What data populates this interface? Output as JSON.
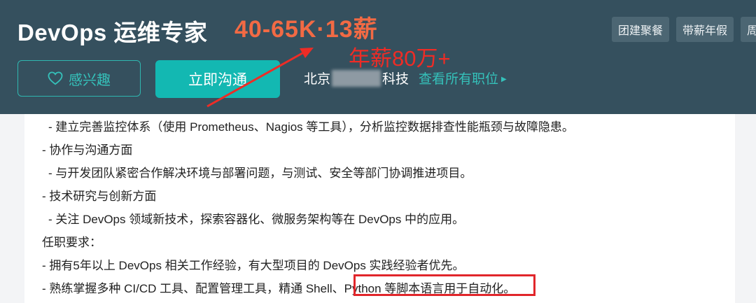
{
  "header": {
    "job_title": "DevOps 运维专家",
    "salary": "40-65K·13薪",
    "annotation": "年薪80万+",
    "tags": [
      "团建聚餐",
      "带薪年假",
      "周"
    ],
    "like_button": "感兴趣",
    "chat_button": "立即沟通",
    "company_prefix": "北京",
    "company_suffix": "科技",
    "all_jobs_link": "查看所有职位"
  },
  "description": {
    "lines": [
      " - 建立完善监控体系（使用 Prometheus、Nagios 等工具），分析监控数据排查性能瓶颈与故障隐患。",
      "- 协作与沟通方面",
      " - 与开发团队紧密合作解决环境与部署问题，与测试、安全等部门协调推进项目。",
      "- 技术研究与创新方面",
      " - 关注 DevOps 领域新技术，探索容器化、微服务架构等在 DevOps 中的应用。",
      "任职要求：",
      "- 拥有5年以上 DevOps 相关工作经验，有大型项目的 DevOps 实践经验者优先。",
      "- 熟练掌握多种 CI/CD 工具、配置管理工具，精通 Shell、Python 等脚本语言用于自动化。"
    ]
  },
  "colors": {
    "header_bg": "#35505e",
    "accent": "#13b8b2",
    "salary": "#f26a44",
    "annotation_red": "#e1262b"
  }
}
